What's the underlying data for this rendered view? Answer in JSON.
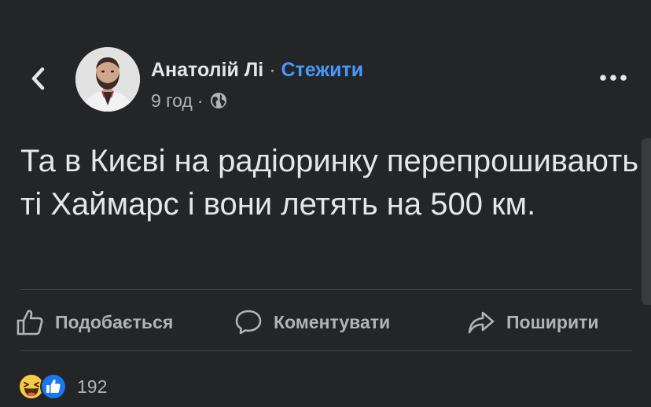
{
  "post": {
    "author": "Анатолій Лі",
    "separator": "·",
    "follow": "Стежити",
    "time": "9 год",
    "meta_separator": "·",
    "privacy_icon": "globe-icon",
    "text": "Та в Києві на радіоринку перепрошивають ті Хаймарс і вони летять на 500 км."
  },
  "actions": {
    "like": "Подобається",
    "comment": "Коментувати",
    "share": "Поширити"
  },
  "reactions": {
    "types": [
      "haha",
      "like"
    ],
    "count": "192"
  },
  "colors": {
    "background": "#242526",
    "text": "#e4e6eb",
    "secondary_text": "#b0b3b8",
    "link": "#4599ff",
    "divider": "#3e4042",
    "like_blue": "#1877f2",
    "haha_yellow": "#f7c94b"
  }
}
